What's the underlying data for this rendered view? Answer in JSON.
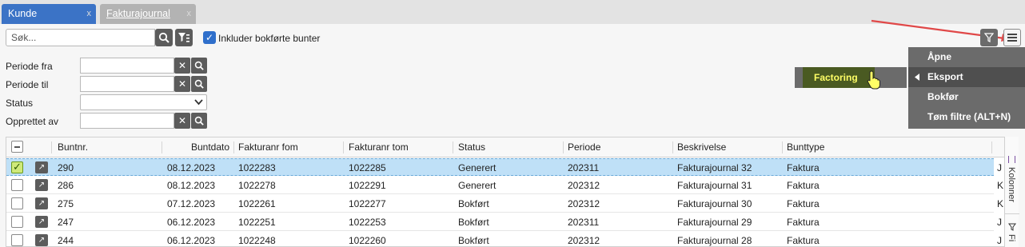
{
  "tabs": [
    {
      "label": "Kunde",
      "close": "x"
    },
    {
      "label": "Fakturajournal",
      "close": "x"
    }
  ],
  "search": {
    "placeholder": "Søk...",
    "include_label": "Inkluder bokførte bunter"
  },
  "filters": {
    "periode_fra": "Periode fra",
    "periode_til": "Periode til",
    "status": "Status",
    "opprettet_av": "Opprettet av",
    "clear_glyph": "✕",
    "chevron": "⌄"
  },
  "menu": {
    "items": [
      "Åpne",
      "Eksport",
      "Bokfør",
      "Tøm filtre (ALT+N)"
    ],
    "submenu_item": "Factoring"
  },
  "grid": {
    "columns": [
      "Buntnr.",
      "Buntdato",
      "Fakturanr fom",
      "Fakturanr tom",
      "Status",
      "Periode",
      "Beskrivelse",
      "Bunttype"
    ],
    "rows": [
      {
        "buntnr": "290",
        "buntdato": "08.12.2023",
        "fom": "1022283",
        "tom": "1022285",
        "status": "Generert",
        "periode": "202311",
        "beskrivelse": "Fakturajournal 32",
        "bunttype": "Faktura",
        "extra": "J"
      },
      {
        "buntnr": "286",
        "buntdato": "08.12.2023",
        "fom": "1022278",
        "tom": "1022291",
        "status": "Generert",
        "periode": "202312",
        "beskrivelse": "Fakturajournal 31",
        "bunttype": "Faktura",
        "extra": "K"
      },
      {
        "buntnr": "275",
        "buntdato": "07.12.2023",
        "fom": "1022261",
        "tom": "1022277",
        "status": "Bokført",
        "periode": "202312",
        "beskrivelse": "Fakturajournal 30",
        "bunttype": "Faktura",
        "extra": "K"
      },
      {
        "buntnr": "247",
        "buntdato": "06.12.2023",
        "fom": "1022251",
        "tom": "1022253",
        "status": "Bokført",
        "periode": "202311",
        "beskrivelse": "Fakturajournal 29",
        "bunttype": "Faktura",
        "extra": "J"
      },
      {
        "buntnr": "244",
        "buntdato": "06.12.2023",
        "fom": "1022248",
        "tom": "1022260",
        "status": "Bokført",
        "periode": "202312",
        "beskrivelse": "Fakturajournal 28",
        "bunttype": "Faktura",
        "extra": "J"
      }
    ]
  },
  "side_panel": {
    "kolonner": "Kolonner",
    "filter": "Fi"
  },
  "colors": {
    "accent": "#3b73c6",
    "selection": "#bfe0f7",
    "menu": "#6b6b6b",
    "highlight": "#ffff66",
    "arrow": "#e04848"
  }
}
